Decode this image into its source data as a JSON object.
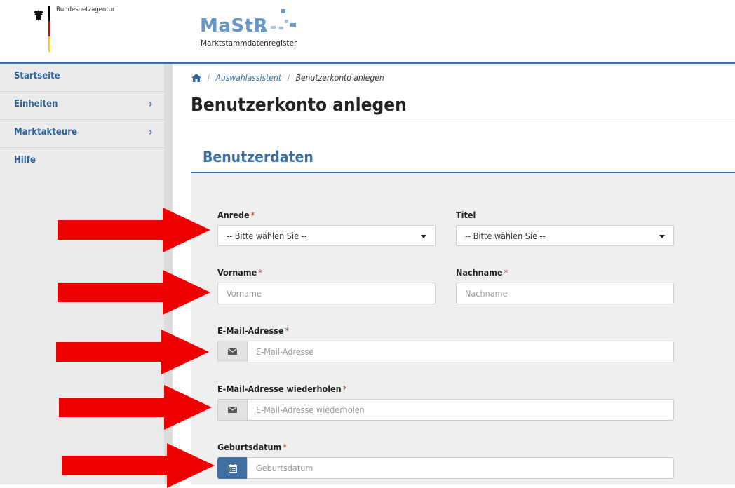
{
  "header": {
    "agency_name": "Bundesnetzagentur",
    "logo_title": "MaStR",
    "logo_subtitle": "Marktstammdatenregister",
    "flag_colors": [
      "#000000",
      "#dd0000",
      "#ffce00"
    ],
    "accent_color": "#3e6fa0"
  },
  "sidebar": {
    "items": [
      {
        "label": "Startseite",
        "has_chevron": false
      },
      {
        "label": "Einheiten",
        "has_chevron": true
      },
      {
        "label": "Marktakteure",
        "has_chevron": true
      },
      {
        "label": "Hilfe",
        "has_chevron": false
      }
    ],
    "chevron_glyph": "›"
  },
  "breadcrumb": {
    "home_icon": "home-icon",
    "separator": "/",
    "items": [
      "Auswahlassistent",
      "Benutzerkonto anlegen"
    ]
  },
  "page_title": "Benutzerkonto anlegen",
  "section_title": "Benutzerdaten",
  "form": {
    "required_marker": "*",
    "anrede": {
      "label": "Anrede",
      "value": "-- Bitte wählen Sie --",
      "required": true
    },
    "titel": {
      "label": "Titel",
      "value": "-- Bitte wählen Sie --",
      "required": false
    },
    "vorname": {
      "label": "Vorname",
      "placeholder": "Vorname",
      "value": "",
      "required": true
    },
    "nachname": {
      "label": "Nachname",
      "placeholder": "Nachname",
      "value": "",
      "required": true
    },
    "email": {
      "label": "E-Mail-Adresse",
      "placeholder": "E-Mail-Adresse",
      "value": "",
      "icon": "envelope-icon",
      "required": true
    },
    "email_repeat": {
      "label": "E-Mail-Adresse wiederholen",
      "placeholder": "E-Mail-Adresse wiederholen",
      "value": "",
      "icon": "envelope-icon",
      "required": true
    },
    "birthdate": {
      "label": "Geburtsdatum",
      "placeholder": "Geburtsdatum",
      "value": "",
      "icon": "calendar-icon",
      "required": true
    }
  },
  "annotations": {
    "arrow_color": "#ee0000",
    "arrow_count": 5
  }
}
